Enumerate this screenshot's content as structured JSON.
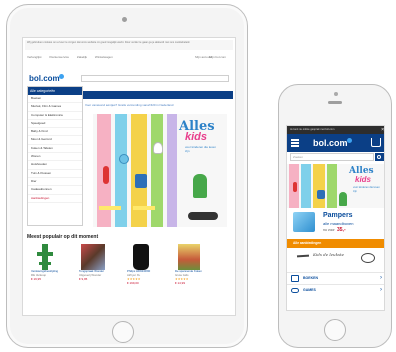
{
  "tablet": {
    "cookie_text": "Wij gebruiken cookies om ervoor te zorgen dat onze website zo goed mogelijk werkt. Door verder te gaan ga je akkoord met ons cookiebeleid.",
    "top_nav": [
      "Verlanglijst",
      "Klantenservice",
      "Zakelijk",
      "Winkelwagen"
    ],
    "top_right": [
      "Mijn account",
      "Mijn bol.com"
    ],
    "logo": "bol.com",
    "nav_items": [
      "Dagelijkse deals",
      "Nieuwe producten",
      "Kerst cadeaus",
      "Nieuwe kinderboeken"
    ],
    "promo": "Voor vanavond ééntjes? Gratis verzending vanaf €20 in Nederland",
    "category_header": "Alle categorieën",
    "categories": [
      "Boeken",
      "Muziek, Film & Games",
      "Computer & Elektronica",
      "Speelgoed",
      "Baby & Kind",
      "Mooi & Gezond",
      "Koken & Tafelen",
      "Wonen",
      "Huishouden",
      "Tuin & Klussen",
      "Dier",
      "Cadeaubonnen",
      "Aanbiedingen"
    ],
    "hero": {
      "title1": "Alles",
      "title2": "kids",
      "subtitle": "voor kinderen die leven zijn"
    },
    "popular_title": "Meest populair op dit moment",
    "products": [
      {
        "name": "Verslavingsbestrijding",
        "seller": "Rik Verkoop",
        "price": "€ 19,95"
      },
      {
        "name": "Tongspraak Wonder",
        "seller": "Uitgeverij Wonder",
        "price": "€ 9,95"
      },
      {
        "name": "Philips HD9240/90",
        "seller": "Airfryer XL",
        "price": "€ 199,00"
      },
      {
        "name": "De spannende Koken",
        "seller": "Grote Gids",
        "price": "€ 14,99"
      }
    ]
  },
  "phone": {
    "top_text": "Je kunt nu online gesprek met bol.com",
    "logo": "bol.com",
    "search_placeholder": "Zoeken",
    "hero": {
      "title1": "Alles",
      "title2": "kids",
      "subtitle": "voor kinderen die leven zijn"
    },
    "pampers": {
      "brand": "Pampers",
      "line": "alle maandboxen",
      "price_label": "nu voor",
      "price": "35,-"
    },
    "orange_bar": "Alle aanbiedingen",
    "handwriting": "Kids de leukste",
    "rows": [
      {
        "label": "BOEKEN"
      },
      {
        "label": "GAMES"
      }
    ]
  },
  "colors": {
    "bol_blue": "#0b3f86",
    "light_blue": "#3da2f0",
    "orange": "#f08c00",
    "price_red": "#c8102e"
  }
}
